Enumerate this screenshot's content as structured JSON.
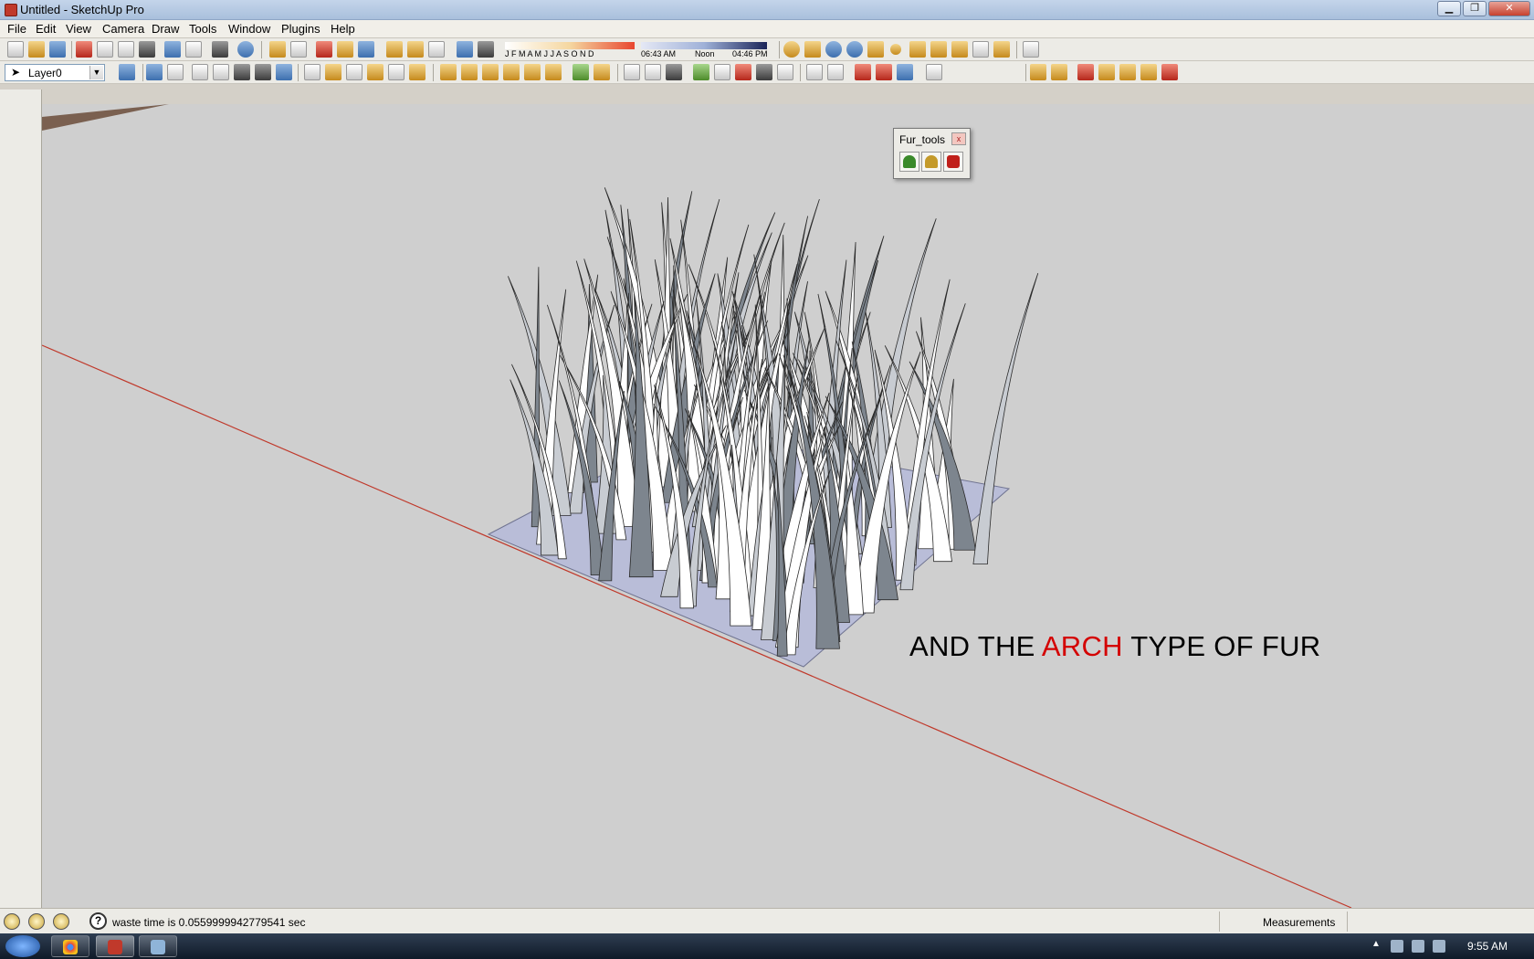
{
  "window": {
    "title": "Untitled - SketchUp Pro",
    "minimize": "▁",
    "maximize": "❐",
    "close": "✕"
  },
  "menu": [
    "File",
    "Edit",
    "View",
    "Camera",
    "Draw",
    "Tools",
    "Window",
    "Plugins",
    "Help"
  ],
  "toolbar": {
    "layer_value": "Layer0",
    "sun_months": "J F M A M J J A S O N D",
    "sun_time_start": "06:43 AM",
    "sun_time_noon": "Noon",
    "sun_time_end": "04:46 PM"
  },
  "fur_tools": {
    "title": "Fur_tools",
    "buttons": [
      "fur-tool-1",
      "fur-tool-2",
      "fur-tool-3"
    ]
  },
  "caption": {
    "part1": "AND THE ",
    "highlight": "ARCH",
    "part2": " TYPE OF FUR",
    "highlight_color": "#d40000"
  },
  "status": {
    "message": "waste time is 0.0559999942779541 sec",
    "help": "?",
    "measurements_label": "Measurements"
  },
  "taskbar": {
    "clock": "9:55 AM",
    "items": [
      "chrome",
      "sketchup",
      "explorer"
    ]
  },
  "colors": {
    "viewport": "#cfcfcf",
    "axis_red": "#c0392b",
    "ground": "#b9bdd8"
  }
}
